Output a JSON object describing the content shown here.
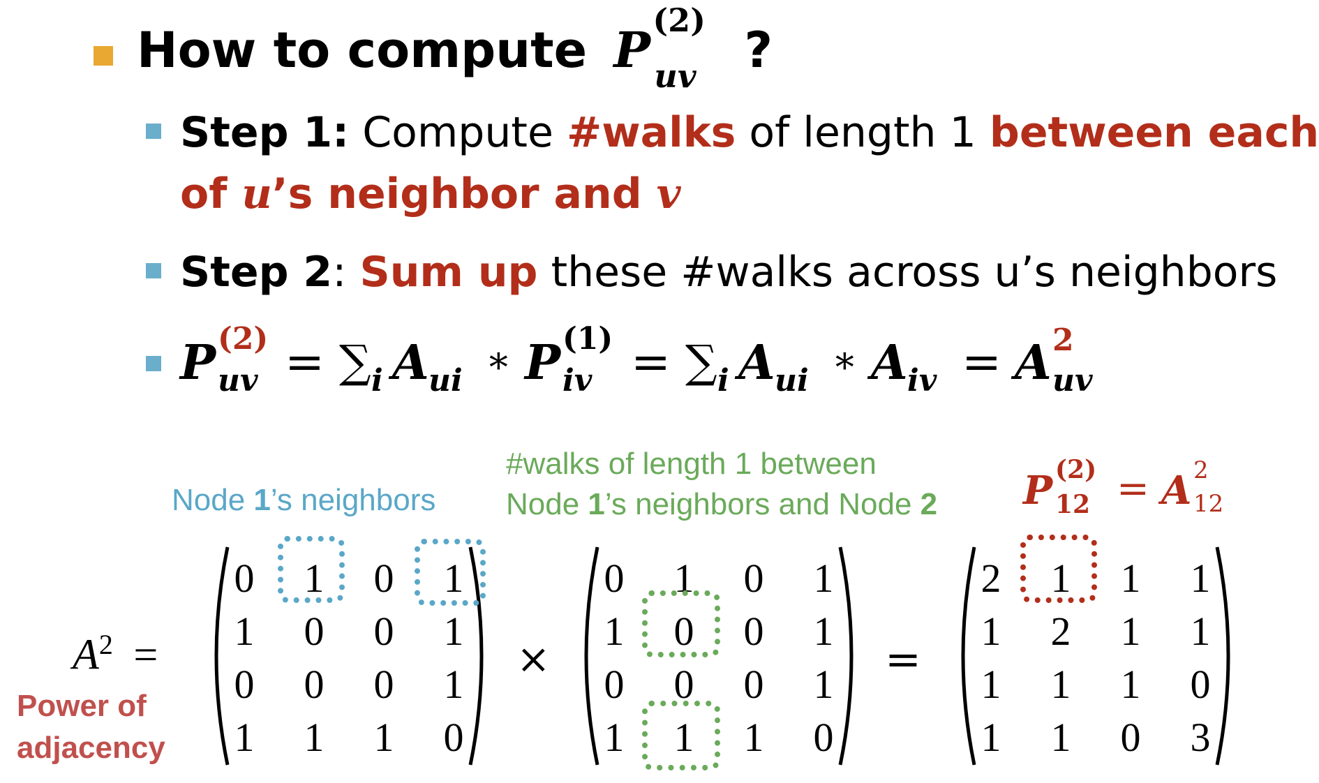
{
  "heading": {
    "text": "How to compute",
    "math_base": "P",
    "math_sup": "(2)",
    "math_sub": "uv",
    "question": "?"
  },
  "steps": {
    "step1": {
      "label": "Step 1:",
      "t1": "Compute",
      "t2": "#walks",
      "t3": "of length",
      "t4": "1",
      "t5": "between each",
      "t6": "of",
      "t7": "u",
      "t8": "’s neighbor and",
      "t9": "v"
    },
    "step2": {
      "label": "Step 2",
      "colon": ":",
      "t1": "Sum up",
      "t2": "these #walks across u’s neighbors"
    },
    "formula": {
      "p": "P",
      "p_sup": "(2)",
      "p_sub": "uv",
      "eq1": "=",
      "sum1": "∑",
      "sum1_sub": "i",
      "a1": "A",
      "a1_sub": "ui",
      "star1": "∗",
      "p2": "P",
      "p2_sup": "(1)",
      "p2_sub": "iv",
      "eq2": "=",
      "sum2": "∑",
      "sum2_sub": "i",
      "a2": "A",
      "a2_sub": "ui",
      "star2": "∗",
      "a3": "A",
      "a3_sub": "iv",
      "eq3": "=",
      "a4": "A",
      "a4_sup": "2",
      "a4_sub": "uv"
    }
  },
  "annotations": {
    "neighbors_pre": "Node ",
    "neighbors_num": "1",
    "neighbors_post": "’s neighbors",
    "walks_line1": "#walks of length 1 between",
    "walks_line2_pre": "Node ",
    "walks_line2_num": "1",
    "walks_line2_mid": "’s neighbors and Node ",
    "walks_line2_num2": "2",
    "p12": "P",
    "p12_sup": "(2)",
    "p12_sub": "12",
    "p12_eq": "=",
    "a12": "A",
    "a12_sup": "2",
    "a12_sub": "12",
    "power_line1": "Power of",
    "power_line2": "adjacency"
  },
  "equation": {
    "lhs_base": "A",
    "lhs_sup": "2",
    "eq": "=",
    "times": "×",
    "eq2": "=",
    "m1": [
      [
        "0",
        "1",
        "0",
        "1"
      ],
      [
        "1",
        "0",
        "0",
        "1"
      ],
      [
        "0",
        "0",
        "0",
        "1"
      ],
      [
        "1",
        "1",
        "1",
        "0"
      ]
    ],
    "m2": [
      [
        "0",
        "1",
        "0",
        "1"
      ],
      [
        "1",
        "0",
        "0",
        "1"
      ],
      [
        "0",
        "0",
        "0",
        "1"
      ],
      [
        "1",
        "1",
        "1",
        "0"
      ]
    ],
    "m3": [
      [
        "2",
        "1",
        "1",
        "1"
      ],
      [
        "1",
        "2",
        "1",
        "1"
      ],
      [
        "1",
        "1",
        "1",
        "0"
      ],
      [
        "1",
        "1",
        "0",
        "3"
      ]
    ]
  },
  "colors": {
    "main_bullet": "#e8a832",
    "sub_bullet": "#6aaecb",
    "red": "#b22e1a",
    "blue": "#5aa7c8",
    "green": "#6aaa5a"
  }
}
